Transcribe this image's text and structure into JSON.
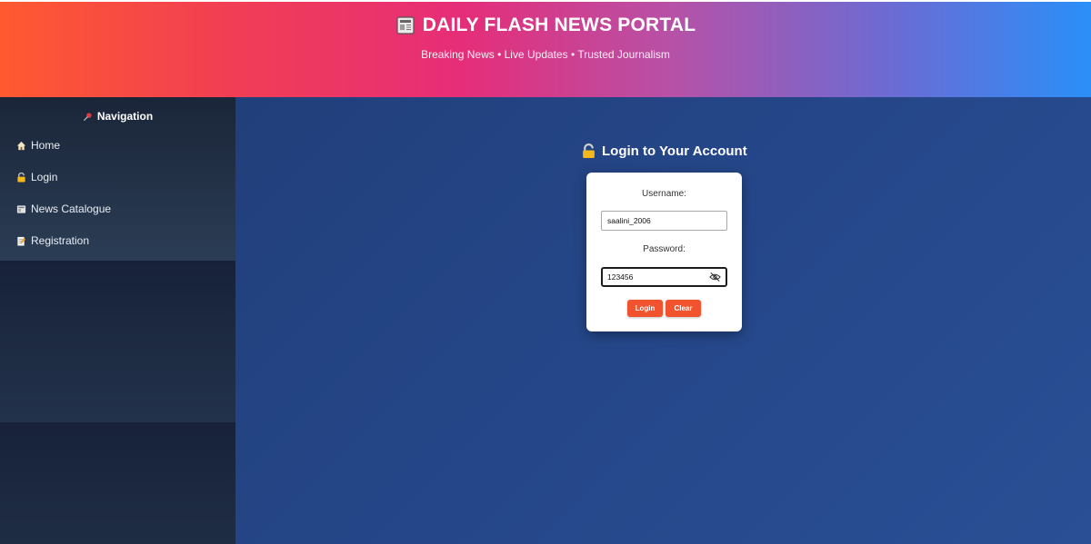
{
  "header": {
    "title": "DAILY FLASH NEWS PORTAL",
    "tagline": "Breaking News • Live Updates • Trusted Journalism",
    "title_icon": "newspaper-icon"
  },
  "sidebar": {
    "heading": "Navigation",
    "heading_icon": "pushpin-icon",
    "items": [
      {
        "label": "Home",
        "icon": "house-icon"
      },
      {
        "label": "Login",
        "icon": "lock-icon"
      },
      {
        "label": "News Catalogue",
        "icon": "newspaper-icon"
      },
      {
        "label": "Registration",
        "icon": "memo-icon"
      }
    ]
  },
  "login": {
    "heading": "Login to Your Account",
    "heading_icon": "lock-icon",
    "username_label": "Username:",
    "username_value": "saalini_2006",
    "password_label": "Password:",
    "password_value": "123456",
    "eye_icon": "eye-slash-icon",
    "login_button": "Login",
    "clear_button": "Clear"
  },
  "colors": {
    "accent": "#f1532f",
    "main_bg": "#25478a",
    "sidebar_bg": "#1a2538"
  }
}
